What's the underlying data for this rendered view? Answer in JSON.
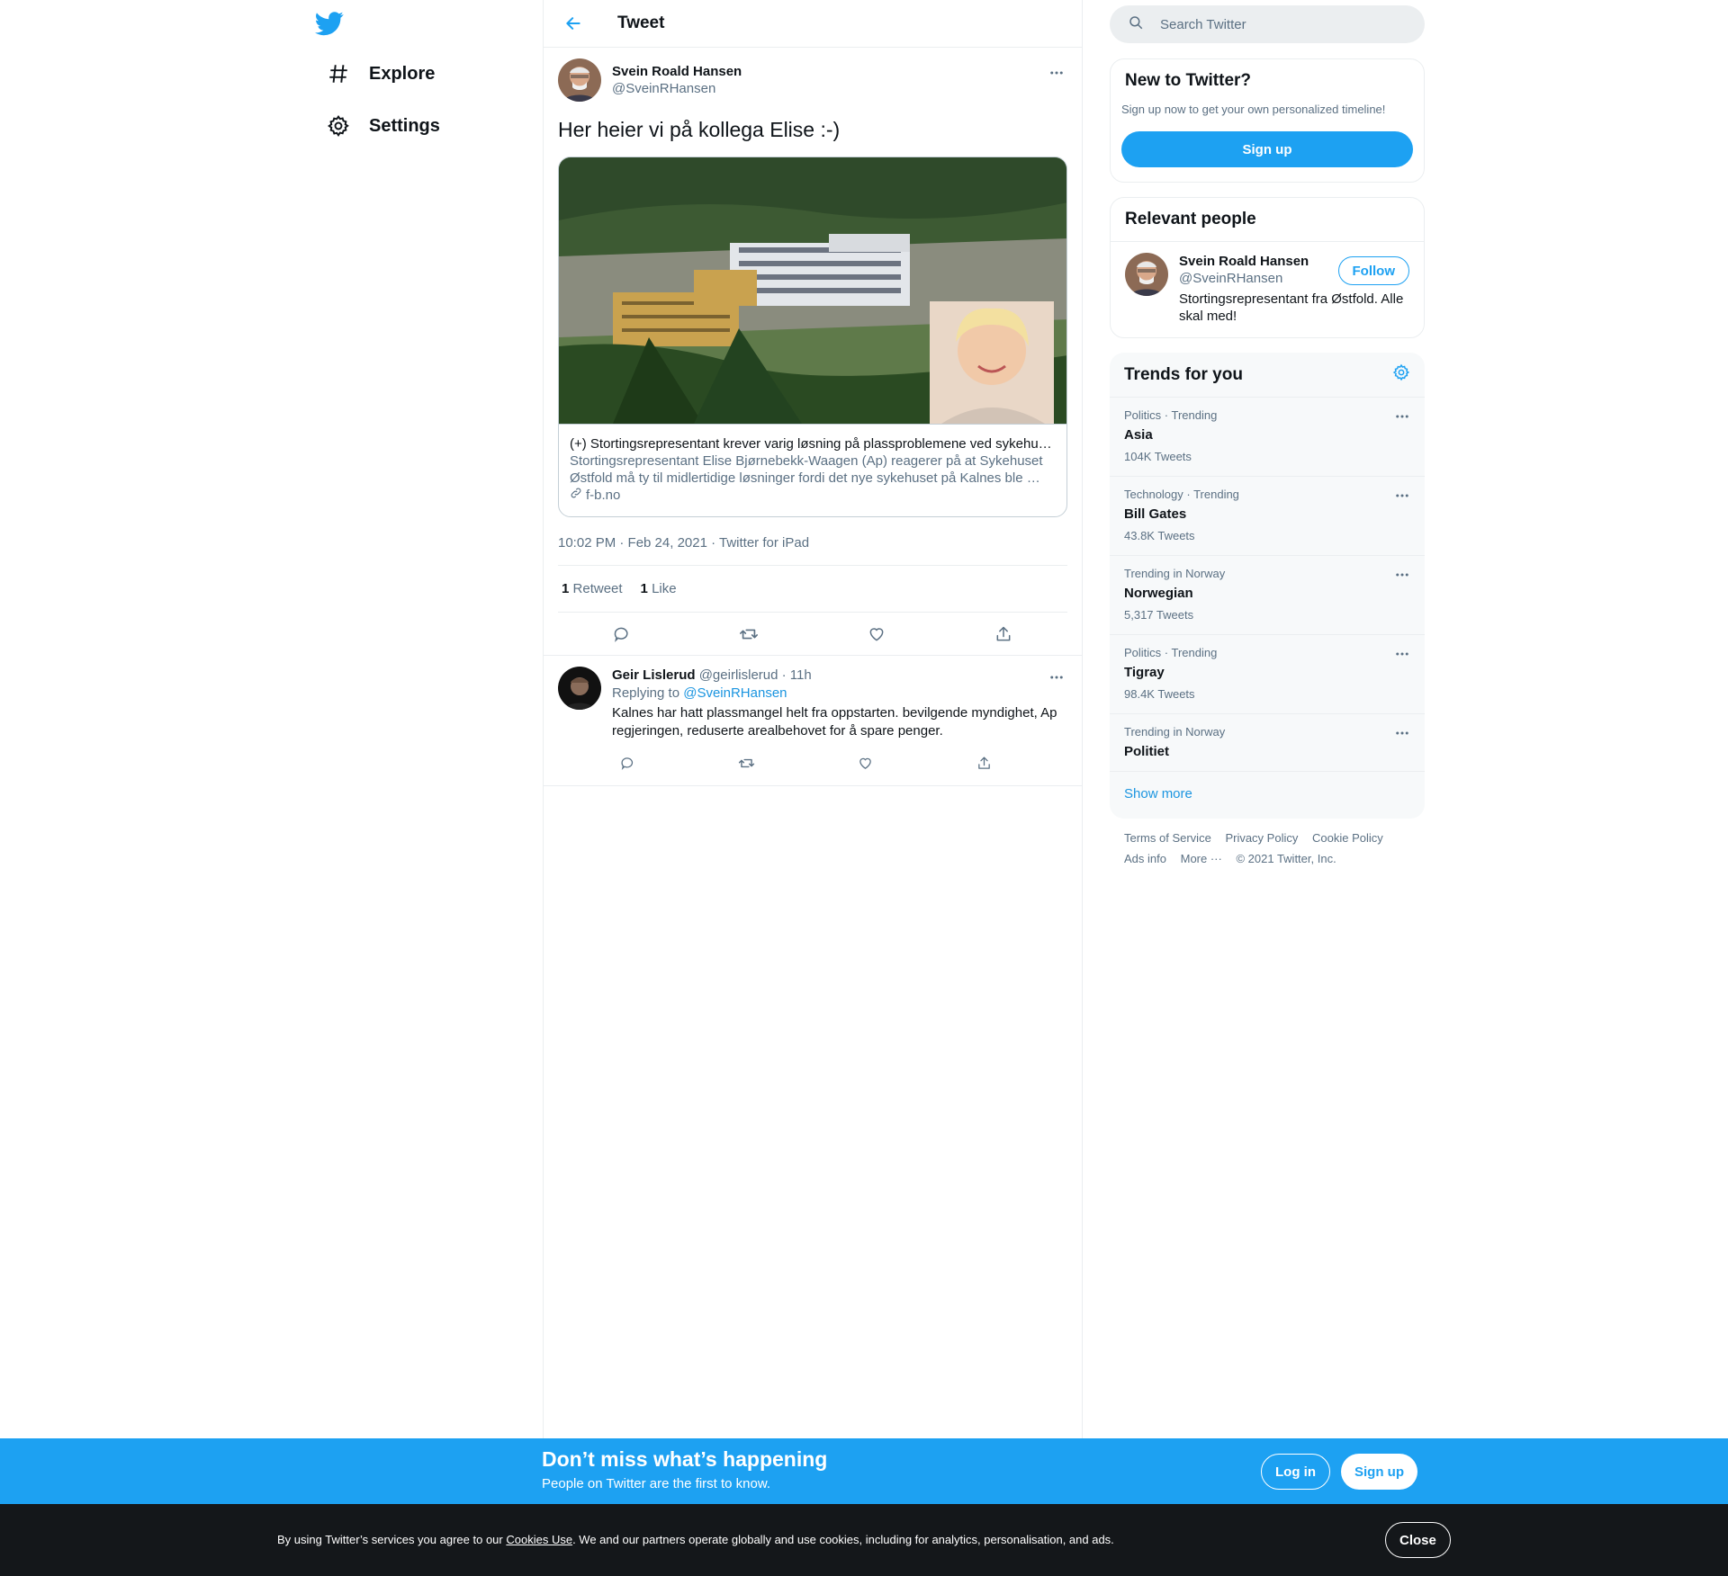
{
  "nav": {
    "explore_label": "Explore",
    "settings_label": "Settings"
  },
  "header": {
    "title": "Tweet"
  },
  "tweet": {
    "author_name": "Svein Roald Hansen",
    "author_handle": "@SveinRHansen",
    "text": "Her heier vi på kollega Elise :-)",
    "card": {
      "title": "(+) Stortingsrepresentant krever varig løsning på plassproblemene ved sykehu…",
      "description": "Stortingsrepresentant Elise Bjørnebekk-Waagen (Ap) reagerer på at Sykehuset Østfold må ty til midlertidige løsninger fordi det nye sykehuset på Kalnes ble …",
      "domain": "f-b.no"
    },
    "meta": "10:02 PM · Feb 24, 2021 · Twitter for iPad",
    "retweets_count": "1",
    "retweets_label": "Retweet",
    "likes_count": "1",
    "likes_label": "Like"
  },
  "reply": {
    "author_name": "Geir Lislerud",
    "author_handle": "@geirlislerud",
    "time": "· 11h",
    "replying_prefix": "Replying to",
    "replying_to": "@SveinRHansen",
    "text": "Kalnes har hatt plassmangel helt fra oppstarten. bevilgende myndighet, Ap regjeringen, reduserte arealbehovet for å spare penger."
  },
  "search": {
    "placeholder": "Search Twitter"
  },
  "new_to_twitter": {
    "title": "New to Twitter?",
    "subtitle": "Sign up now to get your own personalized timeline!",
    "signup_label": "Sign up"
  },
  "relevant_people": {
    "title": "Relevant people",
    "name": "Svein Roald Hansen",
    "handle": "@SveinRHansen",
    "bio": "Stortingsrepresentant fra Østfold. Alle skal med!",
    "follow_label": "Follow"
  },
  "trends": {
    "title": "Trends for you",
    "items": [
      {
        "context": "Politics · Trending",
        "name": "Asia",
        "count": "104K Tweets"
      },
      {
        "context": "Technology · Trending",
        "name": "Bill Gates",
        "count": "43.8K Tweets"
      },
      {
        "context": "Trending in Norway",
        "name": "Norwegian",
        "count": "5,317 Tweets"
      },
      {
        "context": "Politics · Trending",
        "name": "Tigray",
        "count": "98.4K Tweets"
      },
      {
        "context": "Trending in Norway",
        "name": "Politiet",
        "count": ""
      }
    ],
    "show_more": "Show more"
  },
  "footer": {
    "terms": "Terms of Service",
    "privacy": "Privacy Policy",
    "cookie": "Cookie Policy",
    "ads": "Ads info",
    "more": "More ···",
    "copyright": "© 2021 Twitter, Inc."
  },
  "cta": {
    "title": "Don’t miss what’s happening",
    "subtitle": "People on Twitter are the first to know.",
    "login_label": "Log in",
    "signup_label": "Sign up"
  },
  "cookie_banner": {
    "text_before": "By using Twitter’s services you agree to our ",
    "link": "Cookies Use",
    "text_after": ". We and our partners operate globally and use cookies, including for analytics, personalisation, and ads.",
    "close_label": "Close"
  },
  "colors": {
    "brand": "#1da1f2",
    "text_secondary": "#5b7083",
    "border": "#ebeef0",
    "cookie_bg": "#14171a"
  }
}
